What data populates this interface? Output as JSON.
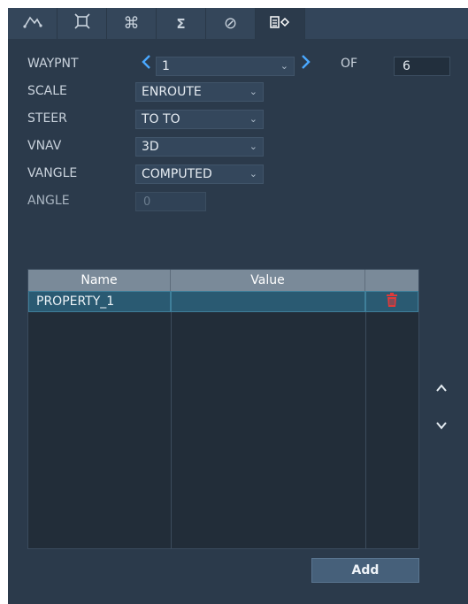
{
  "tabs": [
    {
      "icon": "path-icon",
      "glyph": "≀",
      "active": false
    },
    {
      "icon": "target-frame-icon",
      "glyph": "⌘",
      "active": false
    },
    {
      "icon": "command-icon",
      "glyph": "⌘",
      "active": false
    },
    {
      "icon": "sigma-icon",
      "glyph": "Σ",
      "active": false
    },
    {
      "icon": "no-symbol-icon",
      "glyph": "⊘",
      "active": false
    },
    {
      "icon": "properties-icon",
      "glyph": "≣◇",
      "active": true
    }
  ],
  "waypoint": {
    "label": "WAYPNT",
    "value": "1",
    "of_label": "OF",
    "total": "6"
  },
  "scale": {
    "label": "SCALE",
    "value": "ENROUTE"
  },
  "steer": {
    "label": "STEER",
    "value": "TO TO"
  },
  "vnav": {
    "label": "VNAV",
    "value": "3D"
  },
  "vangle": {
    "label": "VANGLE",
    "value": "COMPUTED"
  },
  "angle": {
    "label": "ANGLE",
    "value": "0"
  },
  "table": {
    "headers": [
      "Name",
      "Value",
      ""
    ],
    "rows": [
      {
        "name": "PROPERTY_1",
        "value": ""
      }
    ]
  },
  "buttons": {
    "add": "Add"
  },
  "colors": {
    "accent": "#4aa8ff",
    "delete": "#e03a3a",
    "selected_row": "#2a5a72"
  }
}
